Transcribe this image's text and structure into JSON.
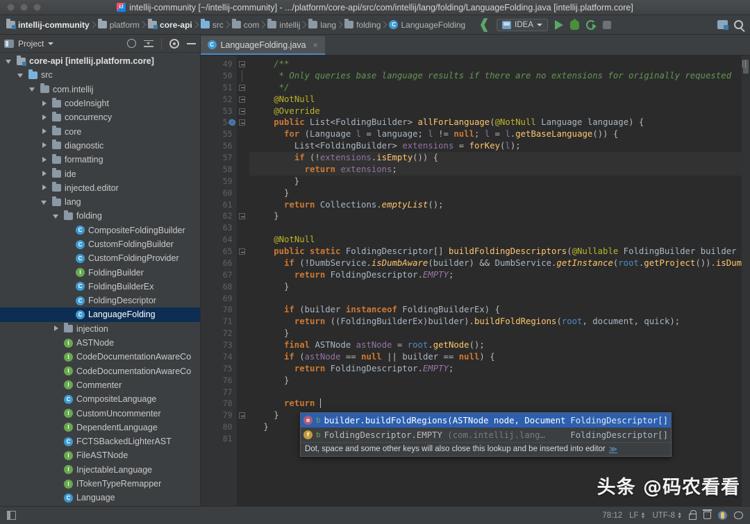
{
  "titlebar": {
    "title": "intellij-community [~/intellij-community] - .../platform/core-api/src/com/intellij/lang/folding/LanguageFolding.java [intellij.platform.core]",
    "app_icon": "intellij-logo-icon"
  },
  "navbar": {
    "breadcrumbs": [
      {
        "label": "intellij-community",
        "icon": "module-folder-icon",
        "bold": true
      },
      {
        "label": "platform",
        "icon": "folder-icon",
        "bold": false
      },
      {
        "label": "core-api",
        "icon": "module-folder-icon",
        "bold": true
      },
      {
        "label": "src",
        "icon": "source-folder-icon",
        "bold": false
      },
      {
        "label": "com",
        "icon": "package-folder-icon",
        "bold": false
      },
      {
        "label": "intellij",
        "icon": "package-folder-icon",
        "bold": false
      },
      {
        "label": "lang",
        "icon": "package-folder-icon",
        "bold": false
      },
      {
        "label": "folding",
        "icon": "package-folder-icon",
        "bold": false
      },
      {
        "label": "LanguageFolding",
        "icon": "class-icon",
        "bold": false
      }
    ],
    "run_config": "IDEA",
    "actions": [
      "back-arrow-icon",
      "run-icon",
      "debug-icon",
      "rerun-icon",
      "stop-icon",
      "project-structure-icon",
      "search-everywhere-icon"
    ]
  },
  "sidebar": {
    "title": "Project",
    "header_icons": [
      "locate-icon",
      "collapse-all-icon",
      "gear-icon",
      "minimize-icon"
    ],
    "tree": [
      {
        "label": "core-api [intellij.platform.core]",
        "indent": 0,
        "toggle": "down",
        "icon": "module-folder-icon",
        "bold": true,
        "selected": false
      },
      {
        "label": "src",
        "indent": 1,
        "toggle": "down",
        "icon": "source-folder-icon",
        "bold": false,
        "selected": false
      },
      {
        "label": "com.intellij",
        "indent": 2,
        "toggle": "down",
        "icon": "package-folder-icon",
        "bold": false,
        "selected": false
      },
      {
        "label": "codeInsight",
        "indent": 3,
        "toggle": "right",
        "icon": "package-folder-icon",
        "bold": false,
        "selected": false
      },
      {
        "label": "concurrency",
        "indent": 3,
        "toggle": "right",
        "icon": "package-folder-icon",
        "bold": false,
        "selected": false
      },
      {
        "label": "core",
        "indent": 3,
        "toggle": "right",
        "icon": "package-folder-icon",
        "bold": false,
        "selected": false
      },
      {
        "label": "diagnostic",
        "indent": 3,
        "toggle": "right",
        "icon": "package-folder-icon",
        "bold": false,
        "selected": false
      },
      {
        "label": "formatting",
        "indent": 3,
        "toggle": "right",
        "icon": "package-folder-icon",
        "bold": false,
        "selected": false
      },
      {
        "label": "ide",
        "indent": 3,
        "toggle": "right",
        "icon": "package-folder-icon",
        "bold": false,
        "selected": false
      },
      {
        "label": "injected.editor",
        "indent": 3,
        "toggle": "right",
        "icon": "package-folder-icon",
        "bold": false,
        "selected": false
      },
      {
        "label": "lang",
        "indent": 3,
        "toggle": "down",
        "icon": "package-folder-icon",
        "bold": false,
        "selected": false
      },
      {
        "label": "folding",
        "indent": 4,
        "toggle": "down",
        "icon": "package-folder-icon",
        "bold": false,
        "selected": false
      },
      {
        "label": "CompositeFoldingBuilder",
        "indent": 5,
        "toggle": "none",
        "icon": "class-icon",
        "bold": false,
        "selected": false
      },
      {
        "label": "CustomFoldingBuilder",
        "indent": 5,
        "toggle": "none",
        "icon": "class-icon",
        "bold": false,
        "selected": false
      },
      {
        "label": "CustomFoldingProvider",
        "indent": 5,
        "toggle": "none",
        "icon": "class-icon",
        "bold": false,
        "selected": false
      },
      {
        "label": "FoldingBuilder",
        "indent": 5,
        "toggle": "none",
        "icon": "interface-icon",
        "bold": false,
        "selected": false
      },
      {
        "label": "FoldingBuilderEx",
        "indent": 5,
        "toggle": "none",
        "icon": "class-icon",
        "bold": false,
        "selected": false
      },
      {
        "label": "FoldingDescriptor",
        "indent": 5,
        "toggle": "none",
        "icon": "class-icon",
        "bold": false,
        "selected": false
      },
      {
        "label": "LanguageFolding",
        "indent": 5,
        "toggle": "none",
        "icon": "class-icon",
        "bold": false,
        "selected": true
      },
      {
        "label": "injection",
        "indent": 4,
        "toggle": "right",
        "icon": "package-folder-icon",
        "bold": false,
        "selected": false
      },
      {
        "label": "ASTNode",
        "indent": 4,
        "toggle": "none",
        "icon": "interface-icon",
        "bold": false,
        "selected": false
      },
      {
        "label": "CodeDocumentationAwareCo",
        "indent": 4,
        "toggle": "none",
        "icon": "interface-icon",
        "bold": false,
        "selected": false
      },
      {
        "label": "CodeDocumentationAwareCo",
        "indent": 4,
        "toggle": "none",
        "icon": "interface-icon",
        "bold": false,
        "selected": false
      },
      {
        "label": "Commenter",
        "indent": 4,
        "toggle": "none",
        "icon": "interface-icon",
        "bold": false,
        "selected": false
      },
      {
        "label": "CompositeLanguage",
        "indent": 4,
        "toggle": "none",
        "icon": "class-icon",
        "bold": false,
        "selected": false
      },
      {
        "label": "CustomUncommenter",
        "indent": 4,
        "toggle": "none",
        "icon": "interface-icon",
        "bold": false,
        "selected": false
      },
      {
        "label": "DependentLanguage",
        "indent": 4,
        "toggle": "none",
        "icon": "interface-icon",
        "bold": false,
        "selected": false
      },
      {
        "label": "FCTSBackedLighterAST",
        "indent": 4,
        "toggle": "none",
        "icon": "class-icon",
        "bold": false,
        "selected": false
      },
      {
        "label": "FileASTNode",
        "indent": 4,
        "toggle": "none",
        "icon": "interface-icon",
        "bold": false,
        "selected": false
      },
      {
        "label": "InjectableLanguage",
        "indent": 4,
        "toggle": "none",
        "icon": "interface-icon",
        "bold": false,
        "selected": false
      },
      {
        "label": "ITokenTypeRemapper",
        "indent": 4,
        "toggle": "none",
        "icon": "interface-icon",
        "bold": false,
        "selected": false
      },
      {
        "label": "Language",
        "indent": 4,
        "toggle": "none",
        "icon": "class-icon",
        "bold": false,
        "selected": false
      }
    ]
  },
  "editor": {
    "tab": {
      "label": "LanguageFolding.java",
      "icon": "java-class-icon",
      "close": "×"
    },
    "first_line_number": 49,
    "lines": [
      {
        "n": 49,
        "fold": "start",
        "html": "    <span class='cmt'>/**</span>"
      },
      {
        "n": 50,
        "fold": "bar",
        "html": "     <span class='cmt'>* Only queries base language results if there are no extensions for originally requested</span>"
      },
      {
        "n": 51,
        "fold": "end",
        "html": "     <span class='cmt'>*/</span>"
      },
      {
        "n": 52,
        "fold": "coll",
        "html": "    <span class='ann'>@NotNull</span>"
      },
      {
        "n": 53,
        "fold": "coll",
        "html": "    <span class='ann'>@Override</span>"
      },
      {
        "n": 54,
        "fold": "start",
        "bookmark": true,
        "html": "    <span class='kw'>public</span> <span class='typ'>List</span>&lt;<span class='typ'>FoldingBuilder</span>&gt; <span class='mth'>allForLanguage</span>(<span class='ann'>@NotNull</span> <span class='typ'>Language</span> <span class='par'>language</span>) {"
      },
      {
        "n": 55,
        "fold": "",
        "html": "      <span class='kw'>for</span> (<span class='typ'>Language</span> <span class='lv'>l</span> = <span class='par'>language</span>; <span class='lv'>l</span> != <span class='kw'>null</span>; <span class='lv'>l</span> = <span class='lv'>l</span>.<span class='mth'>getBaseLanguage</span>()) {"
      },
      {
        "n": 56,
        "fold": "",
        "html": "        <span class='typ'>List</span>&lt;<span class='typ'>FoldingBuilder</span>&gt; <span class='lv'>extensions</span> = <span class='mth'>forKey</span>(<span class='lv'>l</span>);"
      },
      {
        "n": 57,
        "fold": "",
        "hl": true,
        "html": "        <span class='kw'>if</span> (!<span class='lv'>extensions</span>.<span class='mth'>isEmpty</span>()) {"
      },
      {
        "n": 58,
        "fold": "",
        "hl": true,
        "html": "          <span class='kw'>return</span> <span class='lv'>extensions</span>;"
      },
      {
        "n": 59,
        "fold": "",
        "html": "        }"
      },
      {
        "n": 60,
        "fold": "",
        "html": "      }"
      },
      {
        "n": 61,
        "fold": "",
        "html": "      <span class='kw'>return</span> <span class='typ'>Collections</span>.<span class='smth'>emptyList</span>();"
      },
      {
        "n": 62,
        "fold": "end",
        "html": "    }"
      },
      {
        "n": 63,
        "fold": "",
        "html": ""
      },
      {
        "n": 64,
        "fold": "",
        "html": "    <span class='ann'>@NotNull</span>"
      },
      {
        "n": 65,
        "fold": "start",
        "html": "    <span class='kw'>public static</span> <span class='typ'>FoldingDescriptor</span>[] <span class='mth'>buildFoldingDescriptors</span>(<span class='ann'>@Nullable</span> <span class='typ'>FoldingBuilder</span> <span class='par'>builder</span>"
      },
      {
        "n": 66,
        "fold": "",
        "html": "      <span class='kw'>if</span> (!<span class='typ'>DumbService</span>.<span class='smth'>isDumbAware</span>(<span class='par'>builder</span>) &amp;&amp; <span class='typ'>DumbService</span>.<span class='smth'>getInstance</span>(<span class='rootp'>root</span>.<span class='mth'>getProject</span>()).<span class='mth'>isDum</span>"
      },
      {
        "n": 67,
        "fold": "",
        "html": "        <span class='kw'>return</span> <span class='typ'>FoldingDescriptor</span>.<span class='sfld'>EMPTY</span>;"
      },
      {
        "n": 68,
        "fold": "",
        "html": "      }"
      },
      {
        "n": 69,
        "fold": "",
        "html": ""
      },
      {
        "n": 70,
        "fold": "",
        "html": "      <span class='kw'>if</span> (<span class='par'>builder</span> <span class='kw'>instanceof</span> <span class='typ'>FoldingBuilderEx</span>) {"
      },
      {
        "n": 71,
        "fold": "",
        "html": "        <span class='kw'>return</span> ((<span class='typ'>FoldingBuilderEx</span>)<span class='par'>builder</span>).<span class='mth'>buildFoldRegions</span>(<span class='rootp'>root</span>, <span class='par'>document</span>, <span class='par'>quick</span>);"
      },
      {
        "n": 72,
        "fold": "",
        "html": "      }"
      },
      {
        "n": 73,
        "fold": "",
        "html": "      <span class='kw'>final</span> <span class='typ'>ASTNode</span> <span class='lv'>astNode</span> = <span class='rootp'>root</span>.<span class='mth'>getNode</span>();"
      },
      {
        "n": 74,
        "fold": "",
        "html": "      <span class='kw'>if</span> (<span class='lv'>astNode</span> == <span class='kw'>null</span> || <span class='par'>builder</span> == <span class='kw'>null</span>) {"
      },
      {
        "n": 75,
        "fold": "",
        "html": "        <span class='kw'>return</span> <span class='typ'>FoldingDescriptor</span>.<span class='sfld'>EMPTY</span>;"
      },
      {
        "n": 76,
        "fold": "",
        "html": "      }"
      },
      {
        "n": 77,
        "fold": "",
        "html": ""
      },
      {
        "n": 78,
        "fold": "",
        "html": "      <span class='kw'>return</span> <span class='caret'></span>"
      },
      {
        "n": 79,
        "fold": "end",
        "html": "    }"
      },
      {
        "n": 80,
        "fold": "",
        "html": "  }"
      },
      {
        "n": 81,
        "fold": "",
        "html": ""
      }
    ]
  },
  "completion_popup": {
    "items": [
      {
        "icon": "method-icon",
        "visibility": "b",
        "text": "builder.buildFoldRegions(ASTNode node, Document document)",
        "package": "",
        "return_type": "FoldingDescriptor[]",
        "selected": true
      },
      {
        "icon": "field-icon",
        "visibility": "b",
        "text": "FoldingDescriptor.EMPTY",
        "package": "(com.intellij.lang…",
        "return_type": "FoldingDescriptor[]",
        "selected": false
      }
    ],
    "hint": "Dot, space and some other keys will also close this lookup and be inserted into editor",
    "hint_more": "≫"
  },
  "watermark": "头条 @码农看看",
  "statusbar": {
    "left_icon": "toggle-tool-window-icon",
    "caret_position": "78:12",
    "line_separator": "LF",
    "encoding": "UTF-8",
    "icons": [
      "lock-icon",
      "trash-icon",
      "notification-icon",
      "hector-icon"
    ]
  },
  "colors": {
    "accent": "#4a88c7",
    "selection": "#0d2d53",
    "popup_selection": "#2d5faf",
    "editor_bg": "#2b2b2b",
    "chrome_bg": "#3c3f41"
  }
}
